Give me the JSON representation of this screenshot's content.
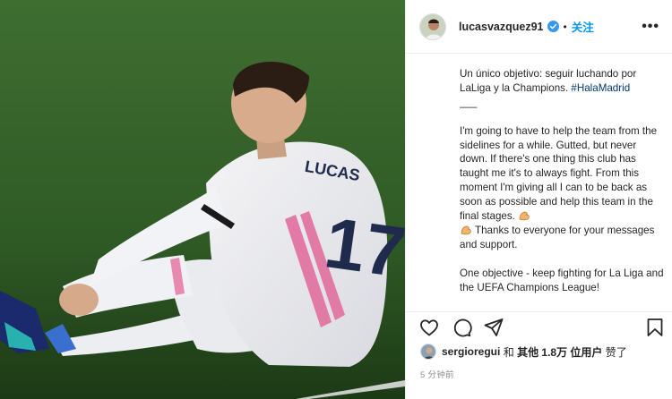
{
  "post": {
    "username": "lucasvazquez91",
    "separator": "•",
    "follow_label": "关注",
    "more_label": "•••",
    "caption": {
      "line1": "Un único objetivo: seguir luchando por LaLiga y la Champions.",
      "hashtag": "#HalaMadrid",
      "divider": "___",
      "para2": "I'm going to have to help the team from the sidelines for a while. Gutted, but never down. If there's one thing this club has taught me it's to always fight. From this moment I'm giving all I can to be back as soon as possible and help this team in the final stages.",
      "para2b": "Thanks to everyone for your messages and support.",
      "para3": "One objective - keep fighting for La Liga and the UEFA Champions League!"
    },
    "likes": {
      "user": "sergioregui",
      "and": "和",
      "others": "其他 1.8万 位用户",
      "liked": "赞了"
    },
    "timestamp": "5 分钟前"
  },
  "photo": {
    "jersey_name": "LUCAS",
    "jersey_number": "17"
  },
  "icons": [
    "verified-badge-icon",
    "heart-icon",
    "comment-icon",
    "share-icon",
    "bookmark-icon",
    "flexed-biceps-emoji"
  ],
  "colors": {
    "follow": "#0095f6",
    "hashtag": "#00376b",
    "muted": "#8e8e8e",
    "verified": "#3897f0"
  }
}
